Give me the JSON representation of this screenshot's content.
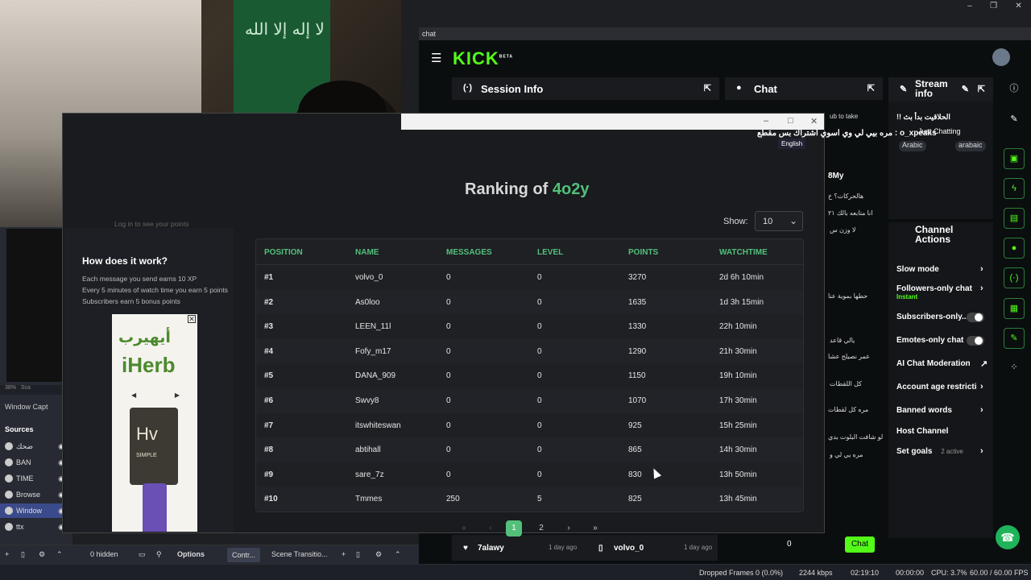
{
  "obs": {
    "window_controls": [
      "–",
      "❐",
      "✕"
    ],
    "left_dock": {
      "zoom": "38%",
      "scale_label": "Sca",
      "window_capture": "Window Capt",
      "sources_title": "Sources",
      "sources": [
        {
          "name": "ضحك"
        },
        {
          "name": "BAN"
        },
        {
          "name": "TIME"
        },
        {
          "name": "Browse"
        },
        {
          "name": "Window"
        },
        {
          "name": "ttx"
        }
      ]
    },
    "bottom": {
      "hidden_count": "0 hidden",
      "options_label": "Options",
      "controls_label": "Contr...",
      "scene_transitions_label": "Scene Transitio..."
    },
    "status": {
      "dropped_frames": "Dropped Frames 0 (0.0%)",
      "bitrate": "2244 kbps",
      "stream_time": "02:19:10",
      "rec_time": "00:00:00",
      "cpu": "CPU: 3.7%",
      "fps": "60.00 / 60.00 FPS"
    }
  },
  "webcam": {
    "flag_text": "لا إله إلا الله"
  },
  "site": {
    "how_title": "How does it work?",
    "how_lines": [
      "Each message you send earns 10 XP",
      "Every 5 minutes of watch time you earn 5 points",
      "Subscribers earn 5 bonus points"
    ],
    "login_hint": "Log in to see your points",
    "ad": {
      "brand_ar": "أيهيرب",
      "brand_en": "iHerb",
      "product_letters": "Hv",
      "product_text": "SIMPLE"
    },
    "ranking_prefix": "Ranking of ",
    "ranking_user": "4o2y",
    "show_label": "Show:",
    "show_value": "10",
    "columns": [
      "POSITION",
      "NAME",
      "MESSAGES",
      "LEVEL",
      "POINTS",
      "WATCHTIME"
    ],
    "rows": [
      {
        "pos": "#1",
        "name": "volvo_0",
        "messages": "0",
        "level": "0",
        "points": "3270",
        "watchtime": "2d 6h 10min"
      },
      {
        "pos": "#2",
        "name": "As0loo",
        "messages": "0",
        "level": "0",
        "points": "1635",
        "watchtime": "1d 3h 15min"
      },
      {
        "pos": "#3",
        "name": "LEEN_11l",
        "messages": "0",
        "level": "0",
        "points": "1330",
        "watchtime": "22h 10min"
      },
      {
        "pos": "#4",
        "name": "Fofy_m17",
        "messages": "0",
        "level": "0",
        "points": "1290",
        "watchtime": "21h 30min"
      },
      {
        "pos": "#5",
        "name": "DANA_909",
        "messages": "0",
        "level": "0",
        "points": "1150",
        "watchtime": "19h 10min"
      },
      {
        "pos": "#6",
        "name": "Swvy8",
        "messages": "0",
        "level": "0",
        "points": "1070",
        "watchtime": "17h 30min"
      },
      {
        "pos": "#7",
        "name": "itswhiteswan",
        "messages": "0",
        "level": "0",
        "points": "925",
        "watchtime": "15h 25min"
      },
      {
        "pos": "#8",
        "name": "abtihall",
        "messages": "0",
        "level": "0",
        "points": "865",
        "watchtime": "14h 30min"
      },
      {
        "pos": "#9",
        "name": "sare_7z",
        "messages": "0",
        "level": "0",
        "points": "830",
        "watchtime": "13h 50min"
      },
      {
        "pos": "#10",
        "name": "Tmmes",
        "messages": "250",
        "level": "5",
        "points": "825",
        "watchtime": "13h 45min"
      }
    ],
    "pagination": {
      "first": "«",
      "prev": "‹",
      "pages": [
        "1",
        "2"
      ],
      "next": "›",
      "last": "»"
    }
  },
  "kick": {
    "window_title": "chat",
    "logo": "KICK",
    "logo_badge": "BETA",
    "session_info": "Session Info",
    "chat": "Chat",
    "stream_info": "Stream info",
    "stream_title": "!! الحلاقيت بدأ بث",
    "category": "Just Chatting",
    "tags": [
      "Arabic",
      "arabaic"
    ],
    "channel_actions": "Channel Actions",
    "actions": [
      {
        "label": "Slow mode",
        "sub": ""
      },
      {
        "label": "Followers-only chat",
        "sub": "Instant"
      },
      {
        "label": "Subscribers-only...",
        "sub": ""
      },
      {
        "label": "Emotes-only chat",
        "sub": ""
      },
      {
        "label": "AI Chat Moderation",
        "sub": ""
      },
      {
        "label": "Account age restricti",
        "sub": ""
      },
      {
        "label": "Banned words",
        "sub": ""
      },
      {
        "label": "Host Channel",
        "sub": ""
      },
      {
        "label": "Set goals",
        "sub": "2 active"
      }
    ],
    "overlay_msg": "مره بيي لي وي اسوي اشتراك بس مقطع : o_xpeaks",
    "overlay_lang": "English",
    "chat_lines": [
      "ub to take",
      "هالحركات؟ خ",
      "انا متابعه بالك ٢١",
      "لا وزن س",
      "حطها بموية عنا",
      "يالي قاعد",
      "عمر نصيلح عشا",
      "كل اللقطات",
      "مره كل لقطات",
      "لو شافت البلوت بدي",
      "مره يي لي و"
    ],
    "pinned_user": "8My",
    "chat_count": "0",
    "chat_button": "Chat",
    "feed": [
      {
        "name": "7alawy",
        "time": "1 day ago"
      },
      {
        "name": "volvo_0",
        "time": "1 day ago"
      }
    ]
  }
}
